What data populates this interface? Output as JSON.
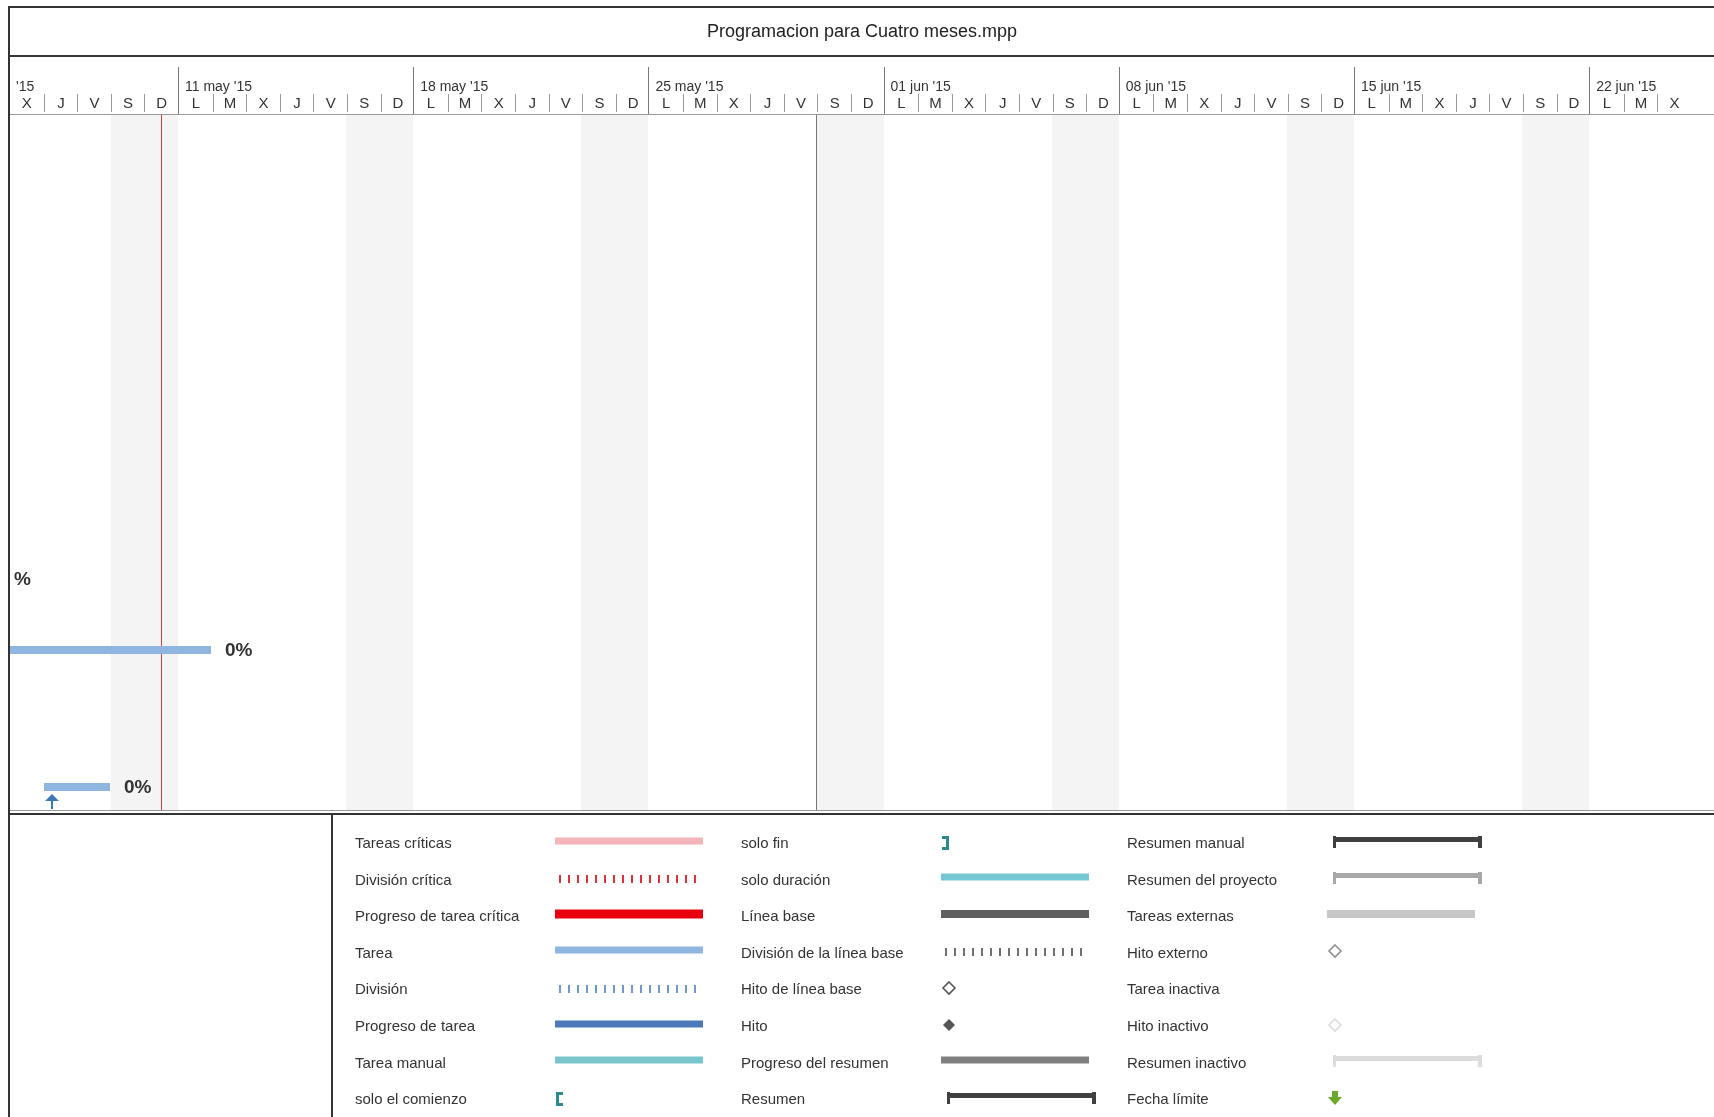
{
  "title": "Programacion para Cuatro meses.mpp",
  "timescale": {
    "weeks": [
      {
        "label": "'15",
        "days": [
          {
            "label": "X",
            "kind": "workday"
          },
          {
            "label": "J",
            "kind": "workday"
          },
          {
            "label": "V",
            "kind": "workday"
          },
          {
            "label": "S",
            "kind": "weekend"
          },
          {
            "label": "D",
            "kind": "weekend"
          }
        ]
      },
      {
        "label": "11 may '15",
        "days": [
          {
            "label": "L",
            "kind": "workday"
          },
          {
            "label": "M",
            "kind": "workday"
          },
          {
            "label": "X",
            "kind": "workday"
          },
          {
            "label": "J",
            "kind": "workday"
          },
          {
            "label": "V",
            "kind": "workday"
          },
          {
            "label": "S",
            "kind": "weekend"
          },
          {
            "label": "D",
            "kind": "weekend"
          }
        ]
      },
      {
        "label": "18 may '15",
        "days": [
          {
            "label": "L",
            "kind": "workday"
          },
          {
            "label": "M",
            "kind": "workday"
          },
          {
            "label": "X",
            "kind": "workday"
          },
          {
            "label": "J",
            "kind": "workday"
          },
          {
            "label": "V",
            "kind": "workday"
          },
          {
            "label": "S",
            "kind": "weekend"
          },
          {
            "label": "D",
            "kind": "weekend"
          }
        ]
      },
      {
        "label": "25 may '15",
        "days": [
          {
            "label": "L",
            "kind": "workday"
          },
          {
            "label": "M",
            "kind": "workday"
          },
          {
            "label": "X",
            "kind": "workday"
          },
          {
            "label": "J",
            "kind": "workday"
          },
          {
            "label": "V",
            "kind": "workday"
          },
          {
            "label": "S",
            "kind": "weekend"
          },
          {
            "label": "D",
            "kind": "weekend"
          }
        ]
      },
      {
        "label": "01 jun '15",
        "days": [
          {
            "label": "L",
            "kind": "workday"
          },
          {
            "label": "M",
            "kind": "workday"
          },
          {
            "label": "X",
            "kind": "workday"
          },
          {
            "label": "J",
            "kind": "workday"
          },
          {
            "label": "V",
            "kind": "workday"
          },
          {
            "label": "S",
            "kind": "weekend"
          },
          {
            "label": "D",
            "kind": "weekend"
          }
        ]
      },
      {
        "label": "08 jun '15",
        "days": [
          {
            "label": "L",
            "kind": "workday"
          },
          {
            "label": "M",
            "kind": "workday"
          },
          {
            "label": "X",
            "kind": "workday"
          },
          {
            "label": "J",
            "kind": "workday"
          },
          {
            "label": "V",
            "kind": "workday"
          },
          {
            "label": "S",
            "kind": "weekend"
          },
          {
            "label": "D",
            "kind": "weekend"
          }
        ]
      },
      {
        "label": "15 jun '15",
        "days": [
          {
            "label": "L",
            "kind": "workday"
          },
          {
            "label": "M",
            "kind": "workday"
          },
          {
            "label": "X",
            "kind": "workday"
          },
          {
            "label": "J",
            "kind": "workday"
          },
          {
            "label": "V",
            "kind": "workday"
          },
          {
            "label": "S",
            "kind": "weekend"
          },
          {
            "label": "D",
            "kind": "weekend"
          }
        ]
      },
      {
        "label": "22 jun '15",
        "days": [
          {
            "label": "L",
            "kind": "workday"
          },
          {
            "label": "M",
            "kind": "workday"
          },
          {
            "label": "X",
            "kind": "workday"
          }
        ]
      }
    ]
  },
  "chart": {
    "rows": [
      {
        "kind": "label",
        "label": "%"
      },
      {
        "kind": "task",
        "label": "0%"
      },
      {
        "kind": "task-start",
        "label": "0%"
      }
    ]
  },
  "legend": {
    "items": [
      {
        "label": "Tareas críticas",
        "kind": "bar",
        "color": "#f4b4b8"
      },
      {
        "label": "División crítica",
        "kind": "split",
        "color": "#e03038"
      },
      {
        "label": "Progreso de tarea crítica",
        "kind": "bar",
        "color": "#e8000c"
      },
      {
        "label": "Tarea",
        "kind": "bar",
        "color": "#8eb6e0"
      },
      {
        "label": "División",
        "kind": "split",
        "color": "#6f98cc"
      },
      {
        "label": "Progreso de tarea",
        "kind": "bar",
        "color": "#4a7ab8"
      },
      {
        "label": "Tarea manual",
        "kind": "bar",
        "color": "#78c6cc"
      },
      {
        "label": "solo el comienzo",
        "kind": "start",
        "color": "#2a8a8c"
      },
      {
        "label": "solo fin",
        "kind": "end",
        "color": "#2a8a8c"
      },
      {
        "label": "solo duración",
        "kind": "bar",
        "color": "#74c8d4"
      },
      {
        "label": "Línea base",
        "kind": "bar",
        "color": "#606060"
      },
      {
        "label": "División de la línea base",
        "kind": "split",
        "color": "#707070"
      },
      {
        "label": "Hito de línea base",
        "kind": "diamond",
        "color": "#555555"
      },
      {
        "label": "Hito",
        "kind": "milestone",
        "color": "#555555"
      },
      {
        "label": "Progreso del resumen",
        "kind": "bar",
        "color": "#808080"
      },
      {
        "label": "Resumen",
        "kind": "summary",
        "color": "#404040"
      },
      {
        "label": "Resumen manual",
        "kind": "summary",
        "color": "#404040"
      },
      {
        "label": "Resumen del proyecto",
        "kind": "summary",
        "color": "#a8a8a8"
      },
      {
        "label": "Tareas externas",
        "kind": "bar",
        "color": "#c8c8c8"
      },
      {
        "label": "Hito externo",
        "kind": "diamond",
        "color": "#909090"
      },
      {
        "label": "Tarea inactiva",
        "kind": "none"
      },
      {
        "label": "Hito inactivo",
        "kind": "diamond",
        "color": "#dddddd"
      },
      {
        "label": "Resumen inactivo",
        "kind": "summary",
        "color": "#dcdcdc"
      },
      {
        "label": "Fecha límite",
        "kind": "deadline",
        "color": "#6aaa2a"
      }
    ]
  }
}
